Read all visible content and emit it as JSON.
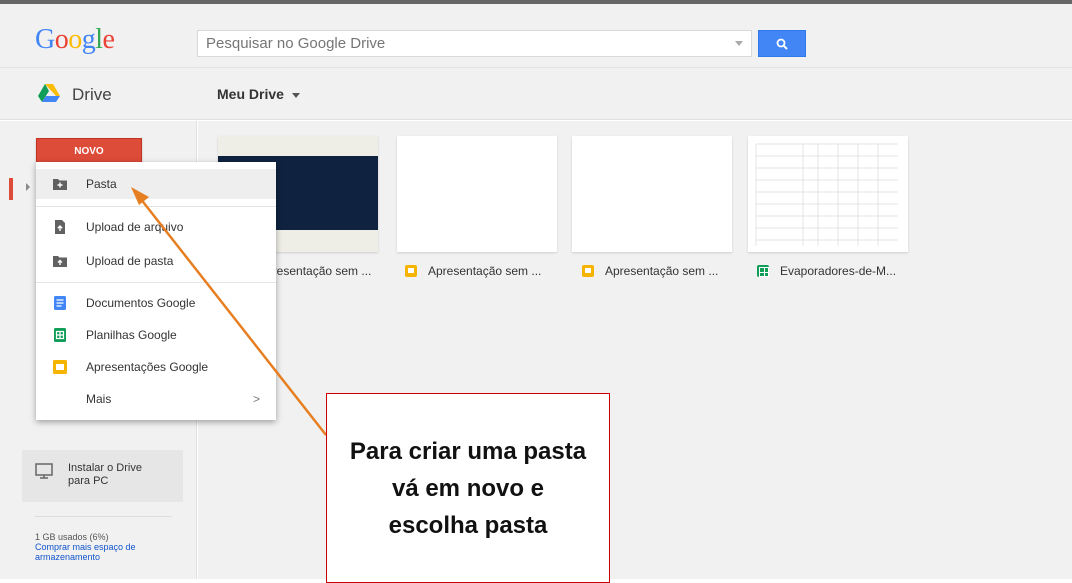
{
  "header": {
    "logo": "Google",
    "search_placeholder": "Pesquisar no Google Drive"
  },
  "subheader": {
    "app_name": "Drive",
    "location": "Meu Drive"
  },
  "sidebar": {
    "new_button": "NOVO",
    "install": {
      "line1": "Instalar o Drive",
      "line2": "para PC"
    },
    "usage": "1 GB usados (6%)",
    "buy_more_line1": "Comprar mais espaço de",
    "buy_more_line2": "armazenamento"
  },
  "new_menu": {
    "items": [
      {
        "label": "Pasta",
        "icon": "folder-add-icon"
      },
      {
        "label": "Upload de arquivo",
        "icon": "file-upload-icon"
      },
      {
        "label": "Upload de pasta",
        "icon": "folder-upload-icon"
      },
      {
        "label": "Documentos Google",
        "icon": "docs-icon"
      },
      {
        "label": "Planilhas Google",
        "icon": "sheets-icon"
      },
      {
        "label": "Apresentações Google",
        "icon": "slides-icon"
      },
      {
        "label": "Mais",
        "icon": "chevron-right-icon"
      }
    ],
    "more_chevron": ">"
  },
  "files": [
    {
      "name": "Apresentação sem ...",
      "type": "slides"
    },
    {
      "name": "Apresentação sem ...",
      "type": "slides"
    },
    {
      "name": "Apresentação sem ...",
      "type": "slides"
    },
    {
      "name": "Evaporadores-de-M...",
      "type": "sheets"
    }
  ],
  "callout": {
    "text": "Para criar uma pasta vá em novo e escolha pasta"
  },
  "colors": {
    "accent_red": "#dd4b39",
    "search_blue": "#4285f4",
    "arrow_orange": "#e67e22",
    "callout_border": "#cc0000"
  }
}
